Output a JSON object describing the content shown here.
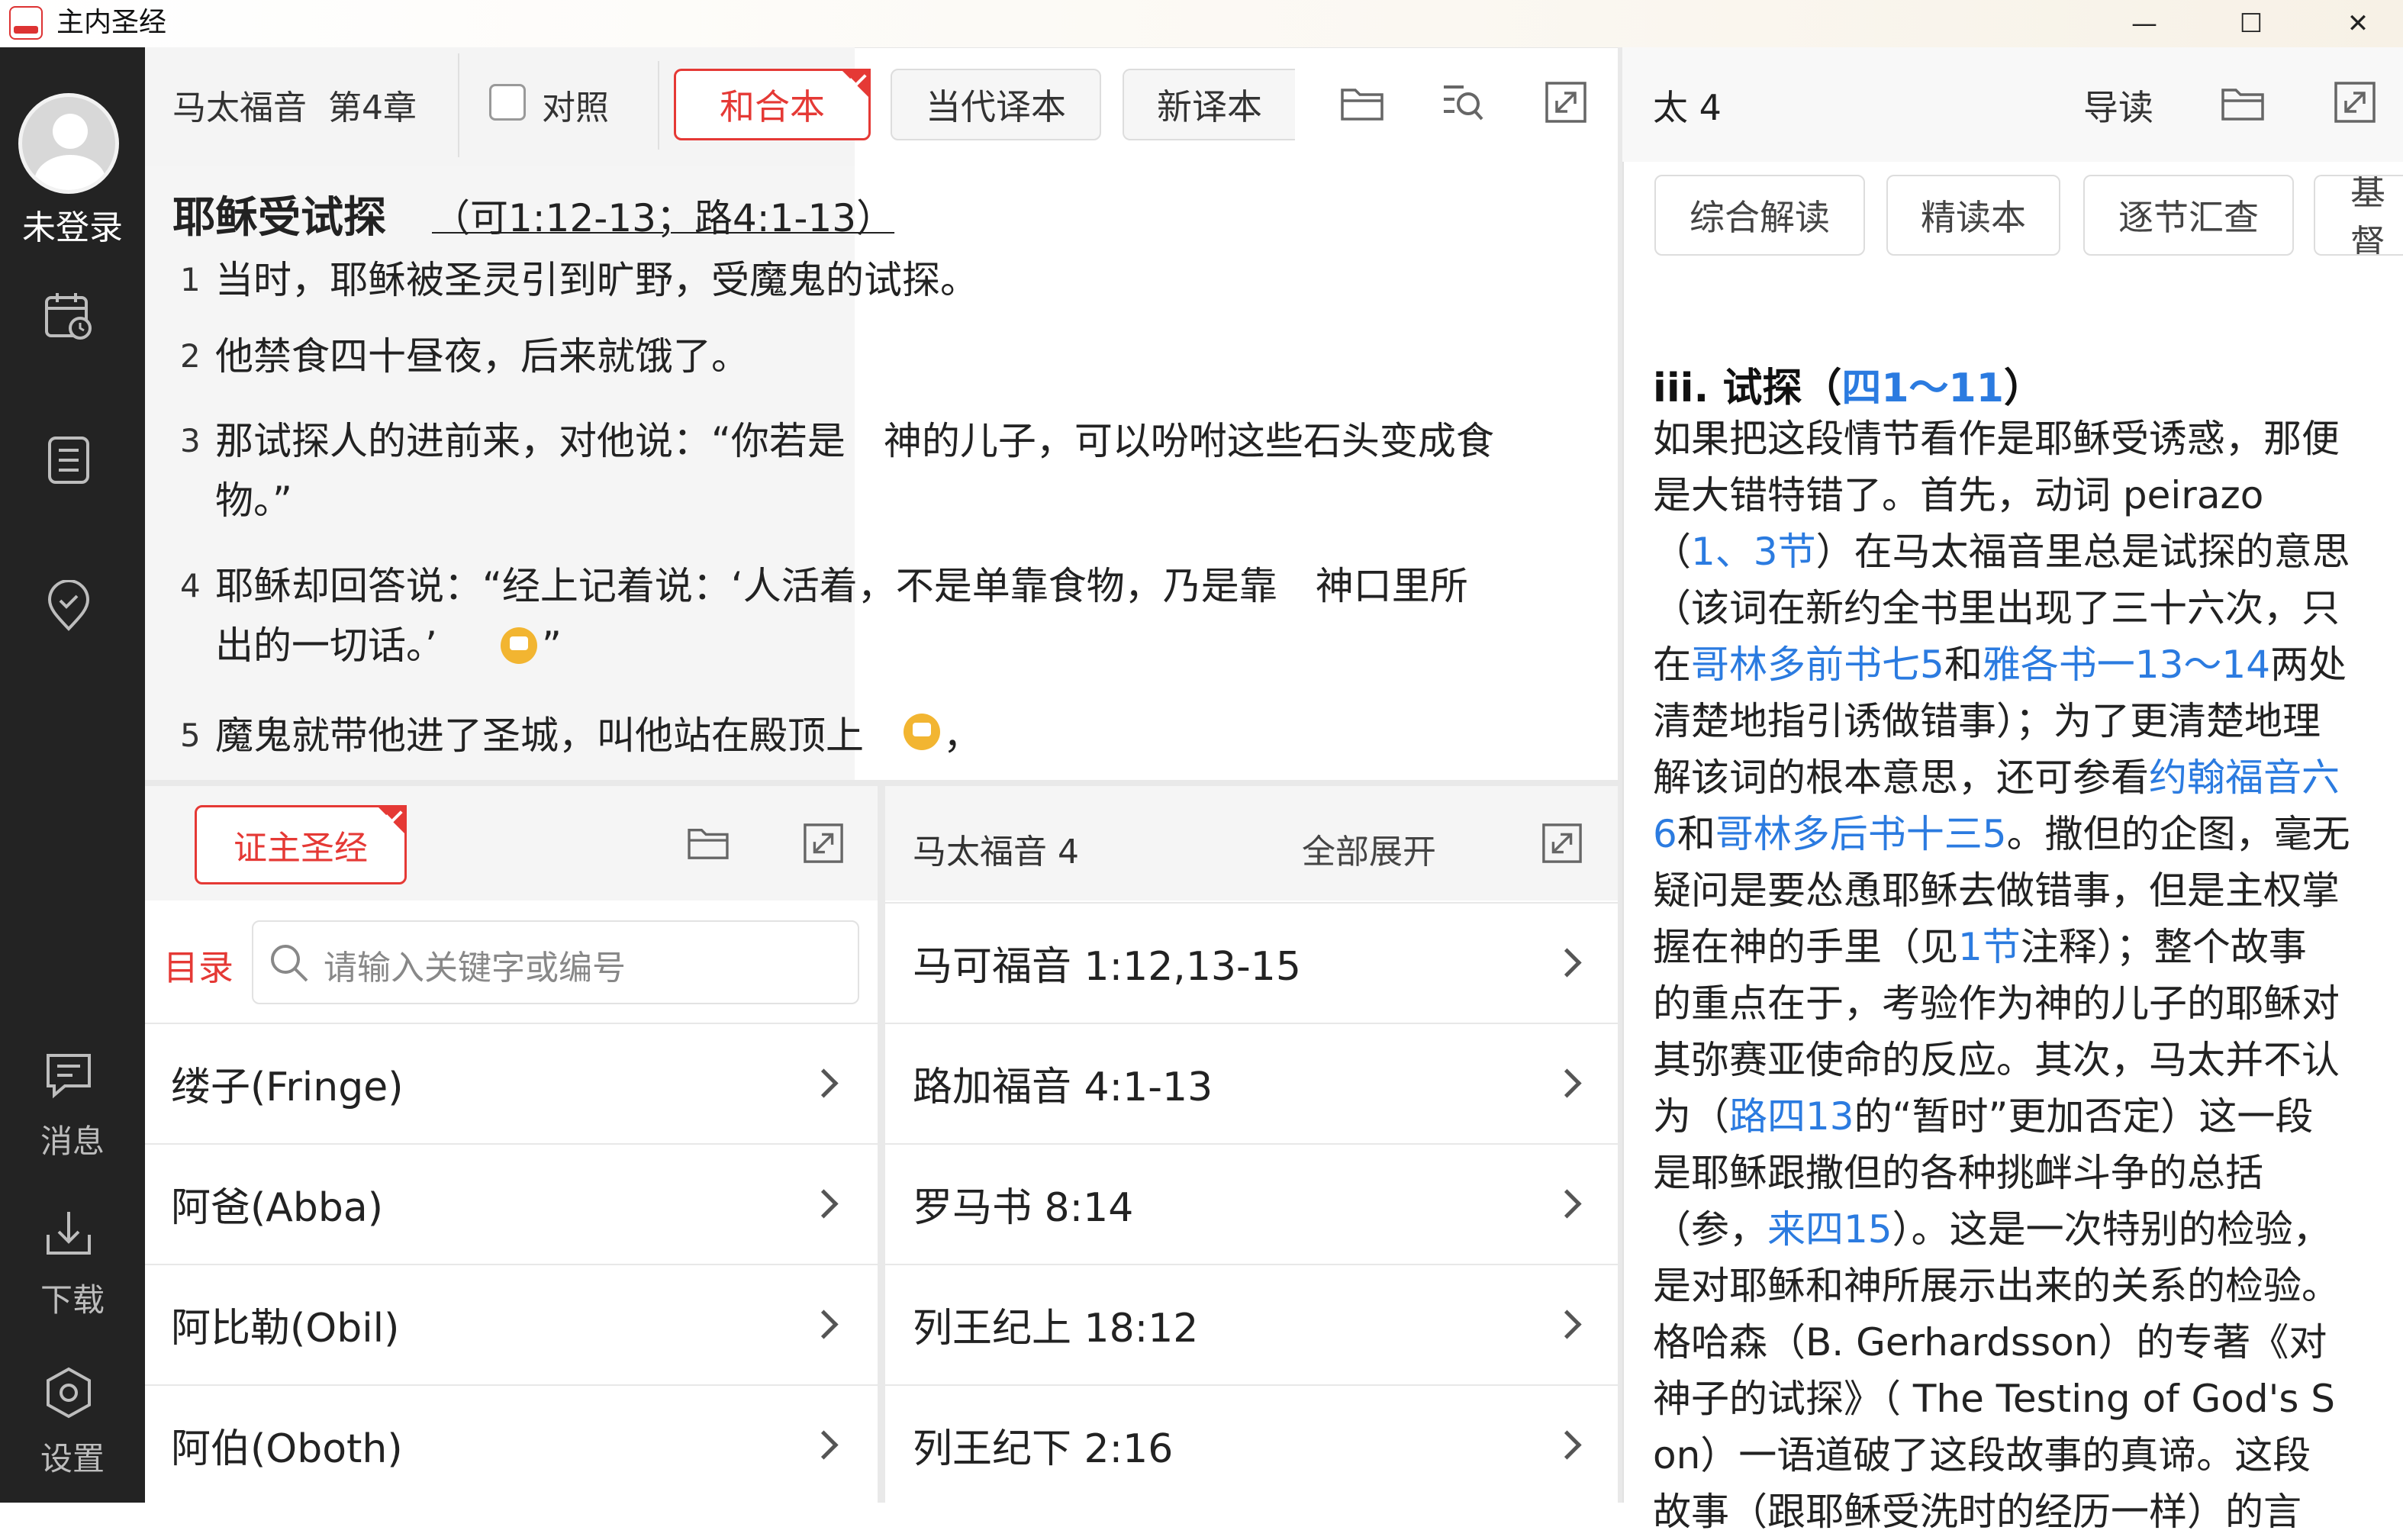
{
  "window": {
    "title": "主内圣经",
    "controls": {
      "minimize": "—",
      "maximize": "☐",
      "close": "✕"
    }
  },
  "sidebar": {
    "user_label": "未登录",
    "items": [
      {
        "icon": "calendar-icon",
        "label": ""
      },
      {
        "icon": "list-icon",
        "label": ""
      },
      {
        "icon": "location-check-icon",
        "label": ""
      },
      {
        "icon": "message-icon",
        "label": "消息"
      },
      {
        "icon": "download-icon",
        "label": "下载"
      },
      {
        "icon": "settings-hexagon-icon",
        "label": "设置"
      }
    ]
  },
  "bible": {
    "book": "马太福音",
    "chapter": "第4章",
    "compare_label": "对照",
    "versions": [
      "和合本",
      "当代译本",
      "新译本"
    ],
    "active_version": "和合本",
    "section_heading": "耶稣受试探",
    "section_refs": "（可1:12-13；路4:1-13）",
    "verses": [
      {
        "num": "1",
        "lines": [
          "当时，耶稣被圣灵引到旷野，受魔鬼的试探。"
        ]
      },
      {
        "num": "2",
        "lines": [
          "他禁食四十昼夜，后来就饿了。"
        ]
      },
      {
        "num": "3",
        "lines": [
          "那试探人的进前来，对他说：“你若是　神的儿子，可以吩咐这些石头变成食",
          "物。”"
        ]
      },
      {
        "num": "4",
        "lines": [
          "耶稣却回答说：“经上记着说：‘人活着，不是单靠食物，乃是靠　神口里所",
          "出的一切话。’"
        ],
        "tail": "”"
      },
      {
        "num": "5",
        "lines": [
          "魔鬼就带他进了圣城，叫他站在殿顶上"
        ],
        "tail": "，"
      }
    ]
  },
  "commentary": {
    "title": "太 4",
    "guide_label": "导读",
    "tabs": [
      "综合解读",
      "精读本",
      "逐节汇查",
      "基督"
    ],
    "heading_prefix": "iii. 试探（",
    "heading_link": "四1～11",
    "heading_suffix": "）",
    "lines": [
      [
        {
          "t": "如果把这段情节看作是耶稣受诱惑，那便"
        }
      ],
      [
        {
          "t": "是大错特错了。首先，动词 peirazo"
        }
      ],
      [
        {
          "t": "（"
        },
        {
          "t": "1、3节",
          "link": true
        },
        {
          "t": "）在马太福音里总是试探的意思"
        }
      ],
      [
        {
          "t": "（该词在新约全书里出现了三十六次，只"
        }
      ],
      [
        {
          "t": "在"
        },
        {
          "t": "哥林多前书七5",
          "link": true
        },
        {
          "t": "和"
        },
        {
          "t": "雅各书一13～14",
          "link": true
        },
        {
          "t": "两处"
        }
      ],
      [
        {
          "t": "清楚地指引诱做错事）；为了更清楚地理"
        }
      ],
      [
        {
          "t": "解该词的根本意思，还可参看"
        },
        {
          "t": "约翰福音六",
          "link": true
        }
      ],
      [
        {
          "t": "6",
          "link": true
        },
        {
          "t": "和"
        },
        {
          "t": "哥林多后书十三5",
          "link": true
        },
        {
          "t": "。撒但的企图，毫无"
        }
      ],
      [
        {
          "t": "疑问是要怂恿耶稣去做错事，但是主权掌"
        }
      ],
      [
        {
          "t": "握在神的手里（见"
        },
        {
          "t": "1节",
          "link": true
        },
        {
          "t": "注释）；整个故事"
        }
      ],
      [
        {
          "t": "的重点在于，考验作为神的儿子的耶稣对"
        }
      ],
      [
        {
          "t": "其弥赛亚使命的反应。其次，马太并不认"
        }
      ],
      [
        {
          "t": "为（"
        },
        {
          "t": "路四13",
          "link": true
        },
        {
          "t": "的“暂时”更加否定）这一段"
        }
      ],
      [
        {
          "t": "是耶稣跟撒但的各种挑衅斗争的总括"
        }
      ],
      [
        {
          "t": "（参，"
        },
        {
          "t": "来四15",
          "link": true
        },
        {
          "t": "）。这是一次特别的检验，"
        }
      ],
      [
        {
          "t": "是对耶稣和神所展示出来的关系的检验。"
        }
      ],
      [
        {
          "t": "格哈森（B. Gerhardsson）的专著《对"
        }
      ],
      [
        {
          "t": "神子的试探》（ The Testing of God's S"
        }
      ],
      [
        {
          "t": "on）一语道破了这段故事的真谛。这段"
        }
      ],
      [
        {
          "t": "故事（跟耶稣受洗时的经历一样）的言"
        }
      ]
    ]
  },
  "dictionary": {
    "tab_label": "证主圣经",
    "toc_label": "目录",
    "search_placeholder": "请输入关键字或编号",
    "items": [
      "缕子(Fringe)",
      "阿爸(Abba)",
      "阿比勒(Obil)",
      "阿伯(Oboth)"
    ]
  },
  "parallel_refs": {
    "title": "马太福音 4",
    "expand_all": "全部展开",
    "items": [
      "马可福音 1:12,13-15",
      "路加福音 4:1-13",
      "罗马书 8:14",
      "列王纪上 18:12",
      "列王纪下 2:16"
    ]
  },
  "colors": {
    "accent_red": "#e53935",
    "link_blue": "#2b7be0",
    "sidebar_bg": "#232323",
    "note_yellow": "#f2b531"
  }
}
